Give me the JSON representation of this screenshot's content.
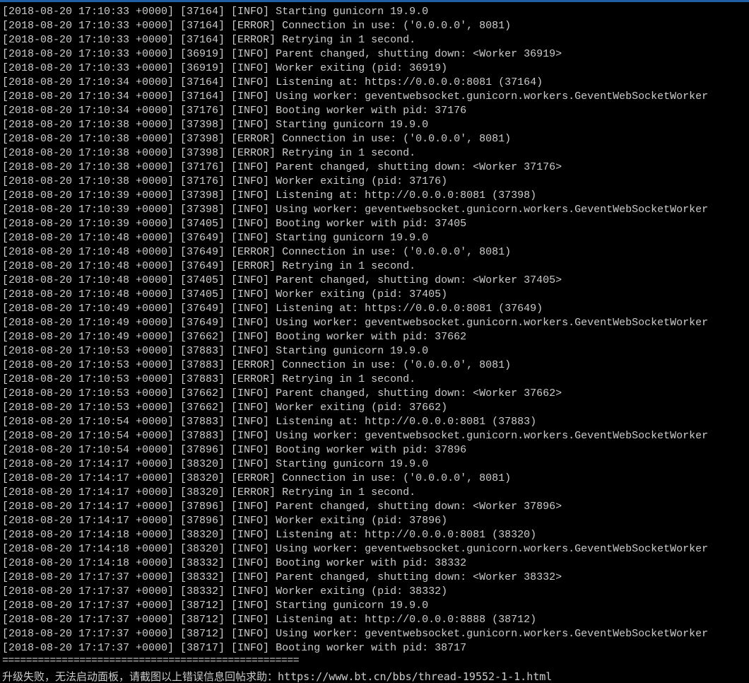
{
  "console": {
    "lines": [
      "[2018-08-20 17:10:33 +0000] [37164] [INFO] Starting gunicorn 19.9.0",
      "[2018-08-20 17:10:33 +0000] [37164] [ERROR] Connection in use: ('0.0.0.0', 8081)",
      "[2018-08-20 17:10:33 +0000] [37164] [ERROR] Retrying in 1 second.",
      "[2018-08-20 17:10:33 +0000] [36919] [INFO] Parent changed, shutting down: <Worker 36919>",
      "[2018-08-20 17:10:33 +0000] [36919] [INFO] Worker exiting (pid: 36919)",
      "[2018-08-20 17:10:34 +0000] [37164] [INFO] Listening at: https://0.0.0.0:8081 (37164)",
      "[2018-08-20 17:10:34 +0000] [37164] [INFO] Using worker: geventwebsocket.gunicorn.workers.GeventWebSocketWorker",
      "[2018-08-20 17:10:34 +0000] [37176] [INFO] Booting worker with pid: 37176",
      "[2018-08-20 17:10:38 +0000] [37398] [INFO] Starting gunicorn 19.9.0",
      "[2018-08-20 17:10:38 +0000] [37398] [ERROR] Connection in use: ('0.0.0.0', 8081)",
      "[2018-08-20 17:10:38 +0000] [37398] [ERROR] Retrying in 1 second.",
      "[2018-08-20 17:10:38 +0000] [37176] [INFO] Parent changed, shutting down: <Worker 37176>",
      "[2018-08-20 17:10:38 +0000] [37176] [INFO] Worker exiting (pid: 37176)",
      "[2018-08-20 17:10:39 +0000] [37398] [INFO] Listening at: http://0.0.0.0:8081 (37398)",
      "[2018-08-20 17:10:39 +0000] [37398] [INFO] Using worker: geventwebsocket.gunicorn.workers.GeventWebSocketWorker",
      "[2018-08-20 17:10:39 +0000] [37405] [INFO] Booting worker with pid: 37405",
      "[2018-08-20 17:10:48 +0000] [37649] [INFO] Starting gunicorn 19.9.0",
      "[2018-08-20 17:10:48 +0000] [37649] [ERROR] Connection in use: ('0.0.0.0', 8081)",
      "[2018-08-20 17:10:48 +0000] [37649] [ERROR] Retrying in 1 second.",
      "[2018-08-20 17:10:48 +0000] [37405] [INFO] Parent changed, shutting down: <Worker 37405>",
      "[2018-08-20 17:10:48 +0000] [37405] [INFO] Worker exiting (pid: 37405)",
      "[2018-08-20 17:10:49 +0000] [37649] [INFO] Listening at: https://0.0.0.0:8081 (37649)",
      "[2018-08-20 17:10:49 +0000] [37649] [INFO] Using worker: geventwebsocket.gunicorn.workers.GeventWebSocketWorker",
      "[2018-08-20 17:10:49 +0000] [37662] [INFO] Booting worker with pid: 37662",
      "[2018-08-20 17:10:53 +0000] [37883] [INFO] Starting gunicorn 19.9.0",
      "[2018-08-20 17:10:53 +0000] [37883] [ERROR] Connection in use: ('0.0.0.0', 8081)",
      "[2018-08-20 17:10:53 +0000] [37883] [ERROR] Retrying in 1 second.",
      "[2018-08-20 17:10:53 +0000] [37662] [INFO] Parent changed, shutting down: <Worker 37662>",
      "[2018-08-20 17:10:53 +0000] [37662] [INFO] Worker exiting (pid: 37662)",
      "[2018-08-20 17:10:54 +0000] [37883] [INFO] Listening at: http://0.0.0.0:8081 (37883)",
      "[2018-08-20 17:10:54 +0000] [37883] [INFO] Using worker: geventwebsocket.gunicorn.workers.GeventWebSocketWorker",
      "[2018-08-20 17:10:54 +0000] [37896] [INFO] Booting worker with pid: 37896",
      "[2018-08-20 17:14:17 +0000] [38320] [INFO] Starting gunicorn 19.9.0",
      "[2018-08-20 17:14:17 +0000] [38320] [ERROR] Connection in use: ('0.0.0.0', 8081)",
      "[2018-08-20 17:14:17 +0000] [38320] [ERROR] Retrying in 1 second.",
      "[2018-08-20 17:14:17 +0000] [37896] [INFO] Parent changed, shutting down: <Worker 37896>",
      "[2018-08-20 17:14:17 +0000] [37896] [INFO] Worker exiting (pid: 37896)",
      "[2018-08-20 17:14:18 +0000] [38320] [INFO] Listening at: http://0.0.0.0:8081 (38320)",
      "[2018-08-20 17:14:18 +0000] [38320] [INFO] Using worker: geventwebsocket.gunicorn.workers.GeventWebSocketWorker",
      "[2018-08-20 17:14:18 +0000] [38332] [INFO] Booting worker with pid: 38332",
      "[2018-08-20 17:17:37 +0000] [38332] [INFO] Parent changed, shutting down: <Worker 38332>",
      "[2018-08-20 17:17:37 +0000] [38332] [INFO] Worker exiting (pid: 38332)",
      "[2018-08-20 17:17:37 +0000] [38712] [INFO] Starting gunicorn 19.9.0",
      "[2018-08-20 17:17:37 +0000] [38712] [INFO] Listening at: http://0.0.0.0:8888 (38712)",
      "[2018-08-20 17:17:37 +0000] [38712] [INFO] Using worker: geventwebsocket.gunicorn.workers.GeventWebSocketWorker",
      "[2018-08-20 17:17:37 +0000] [38717] [INFO] Booting worker with pid: 38717"
    ],
    "separator": "==================================================",
    "notice": "升级失败，无法启动面板，请截图以上错误信息回帖求助：https://www.bt.cn/bbs/thread-19552-1-1.html"
  },
  "colors": {
    "background": "#000000",
    "text": "#cccccc",
    "top_border": "#1f5fa8"
  }
}
